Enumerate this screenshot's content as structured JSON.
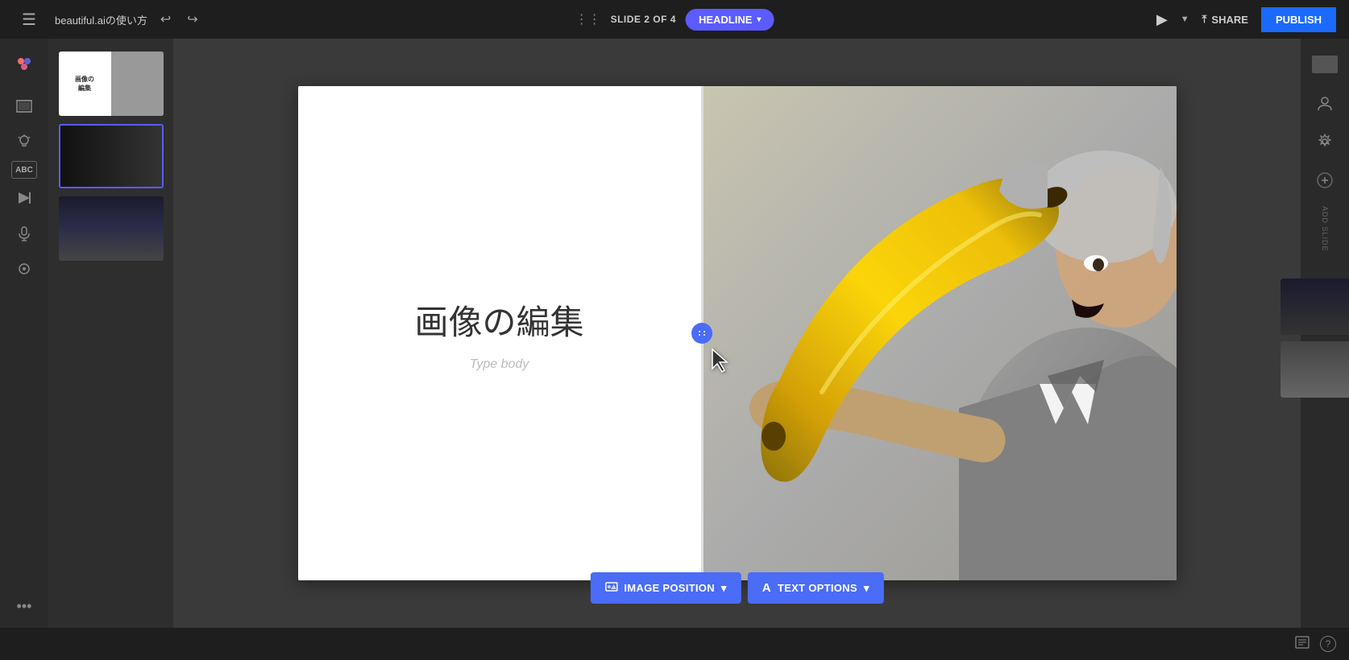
{
  "topbar": {
    "menu_label": "☰",
    "app_title": "beautiful.aiの使い方",
    "undo_label": "↩",
    "redo_label": "↪",
    "grid_icon": "⊞",
    "slide_counter": "SLIDE 2 OF 4",
    "headline_btn_label": "HEADLINE",
    "caret": "▾",
    "play_icon": "▶",
    "dropdown_caret": "▾",
    "share_icon": "⤴",
    "share_label": "SHARE",
    "publish_label": "PUBLISH"
  },
  "sidebar": {
    "logo_icon": "●",
    "icons": [
      {
        "name": "slides-icon",
        "symbol": "▤"
      },
      {
        "name": "lightbulb-icon",
        "symbol": "💡"
      },
      {
        "name": "text-abc-icon",
        "symbol": "ABC"
      },
      {
        "name": "fast-forward-icon",
        "symbol": "⏩"
      },
      {
        "name": "mic-icon",
        "symbol": "🎤"
      },
      {
        "name": "cursor-icon",
        "symbol": "⊕"
      }
    ],
    "dots_label": "•••"
  },
  "slide": {
    "title": "画像の編集",
    "body_placeholder": "Type body",
    "image_alt": "man with banana"
  },
  "toolbar": {
    "image_position_icon": "📷",
    "image_position_label": "IMAGE POSITION",
    "image_position_caret": "▾",
    "text_options_icon": "A",
    "text_options_label": "TEXT OPTIONS",
    "text_options_caret": "▾"
  },
  "right_panel": {
    "thumbnail_icon": "⬜",
    "user_icon": "👤",
    "gear_icon": "⚙"
  },
  "add_slide": {
    "icon": "+",
    "label": "ADD SLIDE"
  },
  "status_bar": {
    "notes_icon": "📝",
    "help_icon": "?"
  }
}
